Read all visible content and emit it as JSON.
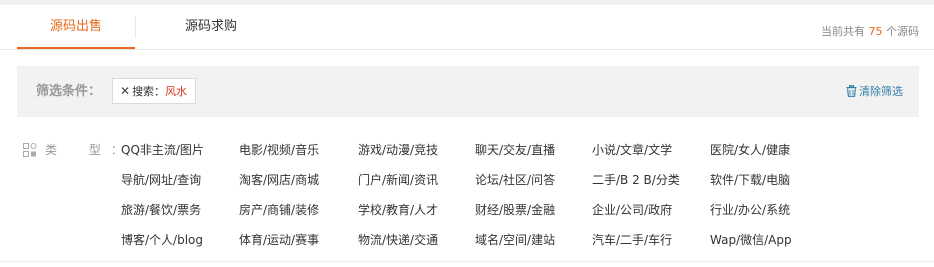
{
  "tabs": [
    {
      "label": "源码出售",
      "active": true
    },
    {
      "label": "源码求购",
      "active": false
    }
  ],
  "count": {
    "prefix": "当前共有 ",
    "value": "75",
    "suffix": " 个源码"
  },
  "filter": {
    "label": "筛选条件：",
    "chip": {
      "prefix": "搜索：",
      "keyword": "风水"
    },
    "clear_label": "清除筛选"
  },
  "types": {
    "label": "类 型",
    "colon": "：",
    "rows": [
      [
        "QQ非主流/图片",
        "电影/视频/音乐",
        "游戏/动漫/竞技",
        "聊天/交友/直播",
        "小说/文章/文学",
        "医院/女人/健康"
      ],
      [
        "导航/网址/查询",
        "淘客/网店/商城",
        "门户/新闻/资讯",
        "论坛/社区/问答",
        "二手/B 2 B/分类",
        "软件/下载/电脑"
      ],
      [
        "旅游/餐饮/票务",
        "房产/商铺/装修",
        "学校/教育/人才",
        "财经/股票/金融",
        "企业/公司/政府",
        "行业/办公/系统"
      ],
      [
        "博客/个人/blog",
        "体育/运动/赛事",
        "物流/快递/交通",
        "域名/空间/建站",
        "汽车/二手/车行",
        "Wap/微信/App"
      ]
    ]
  },
  "colors": {
    "accent": "#e46a1d",
    "keyword": "#d9341c",
    "link": "#2f7fa6"
  },
  "icons": {
    "chip_close": "close-icon",
    "clear": "trash-icon",
    "types": "grid-icon"
  }
}
